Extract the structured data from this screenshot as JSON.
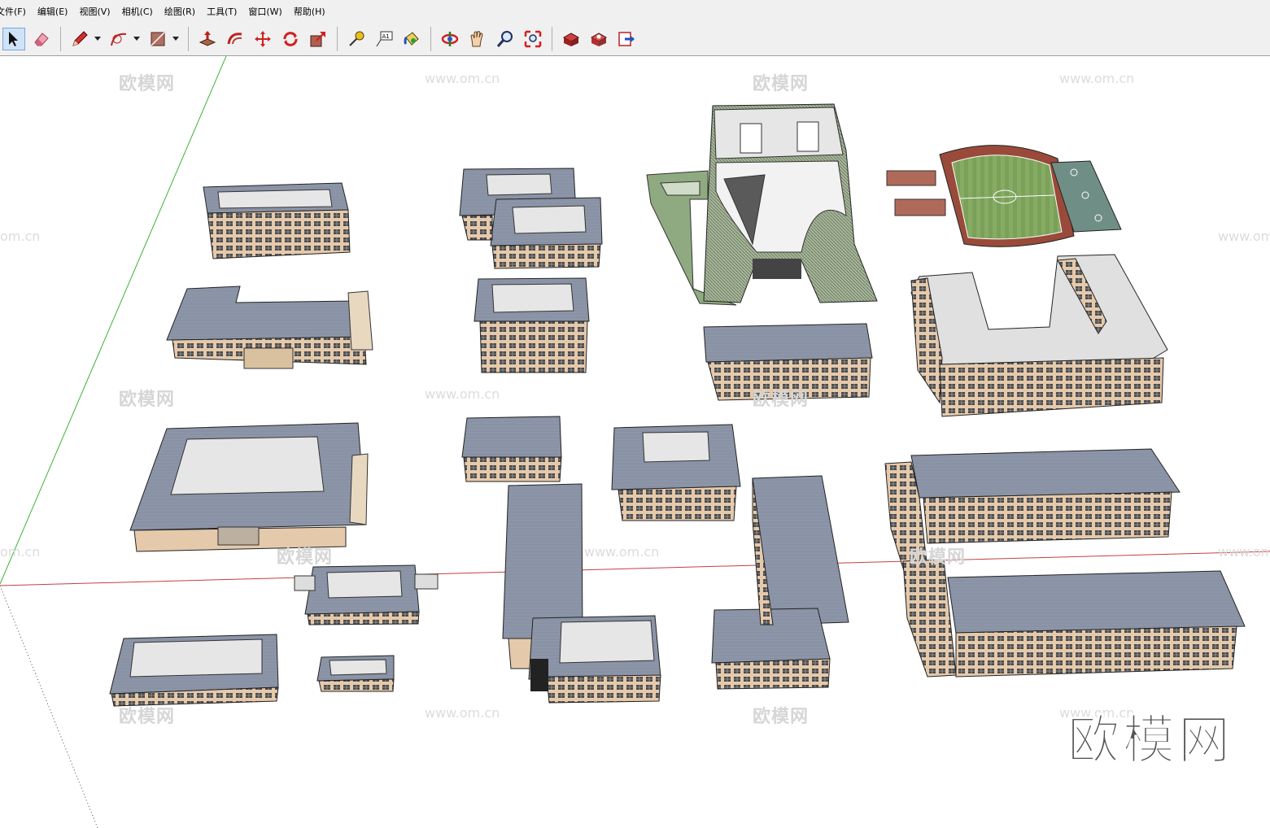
{
  "menu": {
    "items": [
      "文件(F)",
      "编辑(E)",
      "视图(V)",
      "相机(C)",
      "绘图(R)",
      "工具(T)",
      "窗口(W)",
      "帮助(H)"
    ]
  },
  "toolbar": {
    "tools": [
      {
        "name": "select-icon",
        "selected": true
      },
      {
        "name": "eraser-icon"
      },
      {
        "name": "pencil-icon",
        "dropdown": true
      },
      {
        "name": "arc-icon",
        "dropdown": true
      },
      {
        "name": "rectangle-icon",
        "dropdown": true
      },
      {
        "name": "push-pull-icon"
      },
      {
        "name": "offset-icon"
      },
      {
        "name": "move-icon"
      },
      {
        "name": "rotate-icon"
      },
      {
        "name": "scale-icon"
      },
      {
        "name": "tape-measure-icon"
      },
      {
        "name": "text-icon",
        "label": "A1"
      },
      {
        "name": "paint-bucket-icon"
      },
      {
        "name": "orbit-icon"
      },
      {
        "name": "pan-icon"
      },
      {
        "name": "zoom-icon"
      },
      {
        "name": "zoom-extents-icon"
      },
      {
        "name": "warehouse-icon"
      },
      {
        "name": "extension-warehouse-icon"
      },
      {
        "name": "send-to-layout-icon"
      }
    ]
  },
  "watermarks": {
    "cn": "欧模网",
    "url": "www.om.cn",
    "url_partial": "om.cn",
    "brand": "欧模网"
  },
  "colors": {
    "roof": "#8d96a8",
    "roof_flat": "#e6e6e6",
    "wall": "#e5c9ab",
    "field_green": "#7aa05a",
    "track_red": "#9a4a3a",
    "axis_red": "#c04040",
    "axis_green": "#3cb43c"
  }
}
